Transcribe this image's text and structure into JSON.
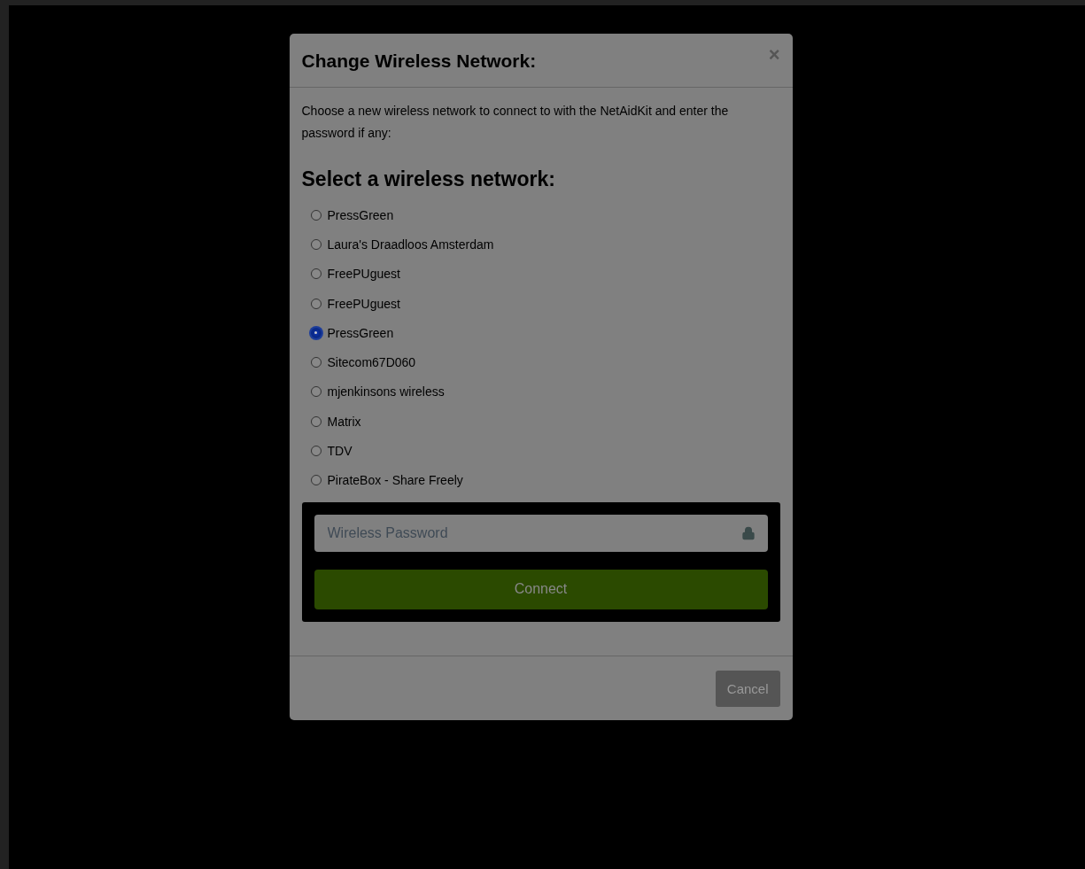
{
  "dialog": {
    "title": "Change Wireless Network:",
    "close": "×",
    "intro": "Choose a new wireless network to connect to with the NetAidKit and enter the password if any:",
    "heading": "Select a wireless network:",
    "networks": [
      {
        "name": "PressGreen",
        "selected": false
      },
      {
        "name": "Laura's Draadloos Amsterdam",
        "selected": false
      },
      {
        "name": "FreePUguest",
        "selected": false
      },
      {
        "name": "FreePUguest",
        "selected": false
      },
      {
        "name": "PressGreen",
        "selected": true
      },
      {
        "name": "Sitecom67D060",
        "selected": false
      },
      {
        "name": "mjenkinsons wireless",
        "selected": false
      },
      {
        "name": "Matrix",
        "selected": false
      },
      {
        "name": "TDV",
        "selected": false
      },
      {
        "name": "PirateBox - Share Freely",
        "selected": false
      }
    ],
    "password": {
      "placeholder": "Wireless Password"
    },
    "connect": "Connect",
    "cancel": "Cancel"
  }
}
